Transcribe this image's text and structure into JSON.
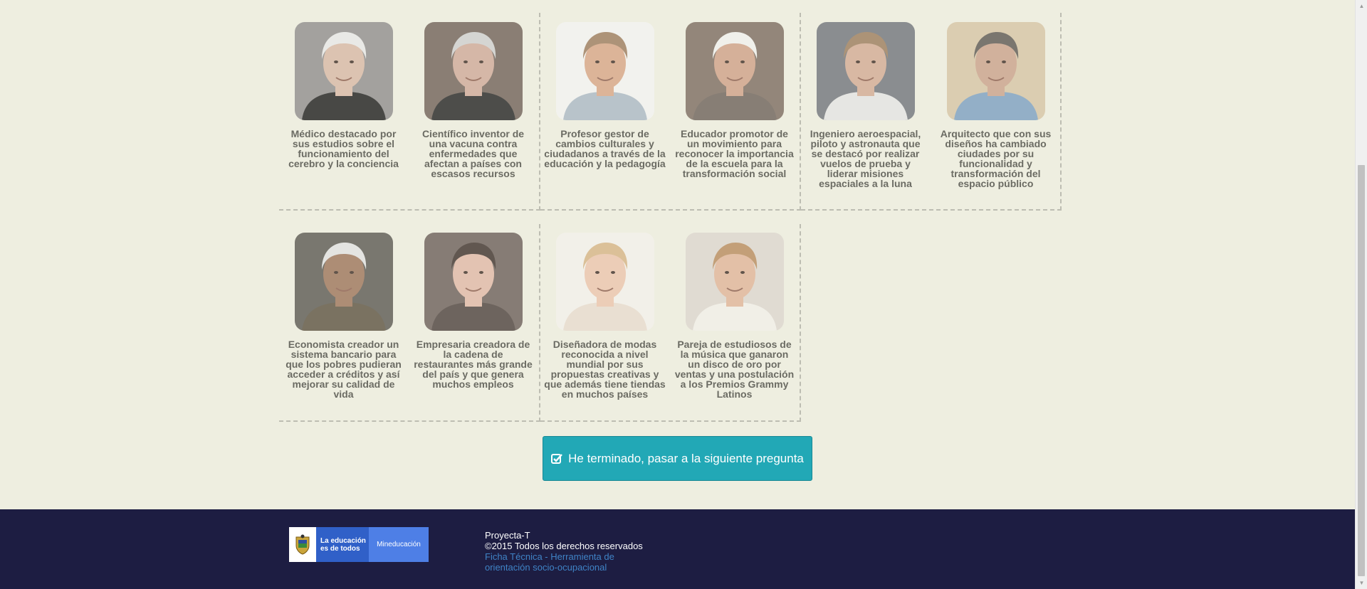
{
  "cards": [
    {
      "caption": "Médico destacado por sus estudios sobre el funcionamiento del cerebro y la conciencia",
      "bg": "#8f8c8c",
      "skin": "#d8b8a4",
      "hair": "#e8e8e8",
      "shirt": "#1a1a1a"
    },
    {
      "caption": "Científico inventor de una vacuna contra enfermedades que afectan a países con escasos recursos",
      "bg": "#6e5f57",
      "skin": "#cfa898",
      "hair": "#cfcfcf",
      "shirt": "#202020"
    },
    {
      "caption": "Profesor gestor de cambios culturales y ciudadanos a través de la educación y la pedagogía",
      "bg": "#f4f4f2",
      "skin": "#d7a584",
      "hair": "#9c7a5c",
      "shirt": "#a9b7c4"
    },
    {
      "caption": "Educador promotor de un movimiento para reconocer la importancia de la escuela para la transformación social",
      "bg": "#7a6a5e",
      "skin": "#cf9f86",
      "hair": "#f1f1ef",
      "shirt": "#6b5f58"
    },
    {
      "caption": "Ingeniero aeroespacial, piloto y astronauta que se destacó por realizar vuelos de prueba y liderar misiones espaciales a la luna",
      "bg": "#6f727a",
      "skin": "#d2aa92",
      "hair": "#9a7a5a",
      "shirt": "#e4e4e4"
    },
    {
      "caption": "Arquitecto que con sus diseños ha cambiado ciudades por su funcionalidad y transformación del espacio público",
      "bg": "#d6c4a4",
      "skin": "#caa08a",
      "hair": "#5a5550",
      "shirt": "#7a9ec0"
    },
    {
      "caption": "Economista creador un sistema bancario para que los pobres pudieran acceder a créditos y así mejorar su calidad de vida",
      "bg": "#595650",
      "skin": "#9c7258",
      "hair": "#e2e2e2",
      "shirt": "#5a503e"
    },
    {
      "caption": "Empresaria creadora de la cadena de restaurantes más grande del país y que genera muchos empleos",
      "bg": "#6a5d58",
      "skin": "#e0b8a6",
      "hair": "#3a2d28",
      "shirt": "#4a3e3a"
    },
    {
      "caption": "Diseñadora de modas reconocida a nivel mundial por sus propuestas creativas y que además tiene tiendas en muchos países",
      "bg": "#f4f1ec",
      "skin": "#ecc4ac",
      "hair": "#d6b485",
      "shirt": "#e8dccf"
    },
    {
      "caption": "Pareja de estudiosos de la música que ganaron un disco de oro por ventas y una postulación a los Premios Grammy Latinos",
      "bg": "#ddd6cf",
      "skin": "#e0b498",
      "hair": "#b78a5c",
      "shirt": "#f2f0ea"
    }
  ],
  "cta": {
    "label": "He terminado, pasar a la siguiente pregunta",
    "color": "#22a8b6"
  },
  "footer": {
    "logo_line1": "La educación",
    "logo_line2": "es de todos",
    "logo_right": "Mineducación",
    "line1": "Proyecta-T",
    "line2": "©2015 Todos los derechos reservados",
    "link": "Ficha Técnica - Herramienta de orientación socio-ocupacional"
  }
}
